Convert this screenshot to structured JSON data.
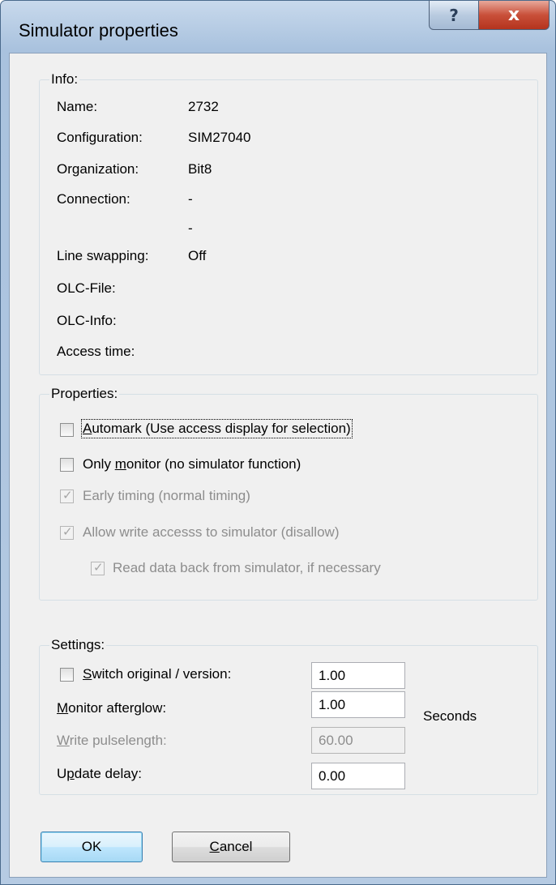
{
  "window": {
    "title": "Simulator properties",
    "help_glyph": "?",
    "close_glyph": "x"
  },
  "info": {
    "legend": "Info:",
    "rows": [
      {
        "label": "Name:",
        "value": "2732"
      },
      {
        "label": "Configuration:",
        "value": "SIM27040"
      },
      {
        "label": "Organization:",
        "value": "Bit8"
      },
      {
        "label": "Connection:",
        "value": "-"
      },
      {
        "label": "",
        "value": "-"
      },
      {
        "label": "Line swapping:",
        "value": "Off"
      },
      {
        "label": "OLC-File:",
        "value": ""
      },
      {
        "label": "OLC-Info:",
        "value": ""
      },
      {
        "label": "Access time:",
        "value": ""
      }
    ]
  },
  "properties": {
    "legend": "Properties:",
    "automark": {
      "pre": "",
      "acc": "A",
      "post": "utomark (Use access display for selection)",
      "checked": false,
      "enabled": true
    },
    "only_monitor": {
      "pre": "Only ",
      "acc": "m",
      "post": "onitor (no simulator function)",
      "checked": false,
      "enabled": true
    },
    "early_timing": {
      "label": "Early timing (normal timing)",
      "checked": true,
      "enabled": false
    },
    "allow_write": {
      "label": "Allow write accesss to simulator (disallow)",
      "checked": true,
      "enabled": false
    },
    "read_back": {
      "label": "Read data back from simulator, if necessary",
      "checked": true,
      "enabled": false
    }
  },
  "settings": {
    "legend": "Settings:",
    "switch_original": {
      "pre": "",
      "acc": "S",
      "post": "witch original / version:",
      "value": "1.00",
      "checked": false
    },
    "monitor_afterglow": {
      "pre": "",
      "acc": "M",
      "post": "onitor afterglow:",
      "value": "1.00"
    },
    "write_pulselength": {
      "pre": "",
      "acc": "W",
      "post": "rite pulselength:",
      "value": "60.00",
      "enabled": false
    },
    "update_delay": {
      "pre": "U",
      "acc": "p",
      "post": "date delay:",
      "value": "0.00"
    },
    "units": "Seconds"
  },
  "buttons": {
    "ok": "OK",
    "cancel": {
      "pre": "",
      "acc": "C",
      "post": "ancel"
    }
  },
  "colors": {
    "accent": "#3c7fb1",
    "disabled_text": "#8d8d8d",
    "close_red": "#c9503a"
  }
}
